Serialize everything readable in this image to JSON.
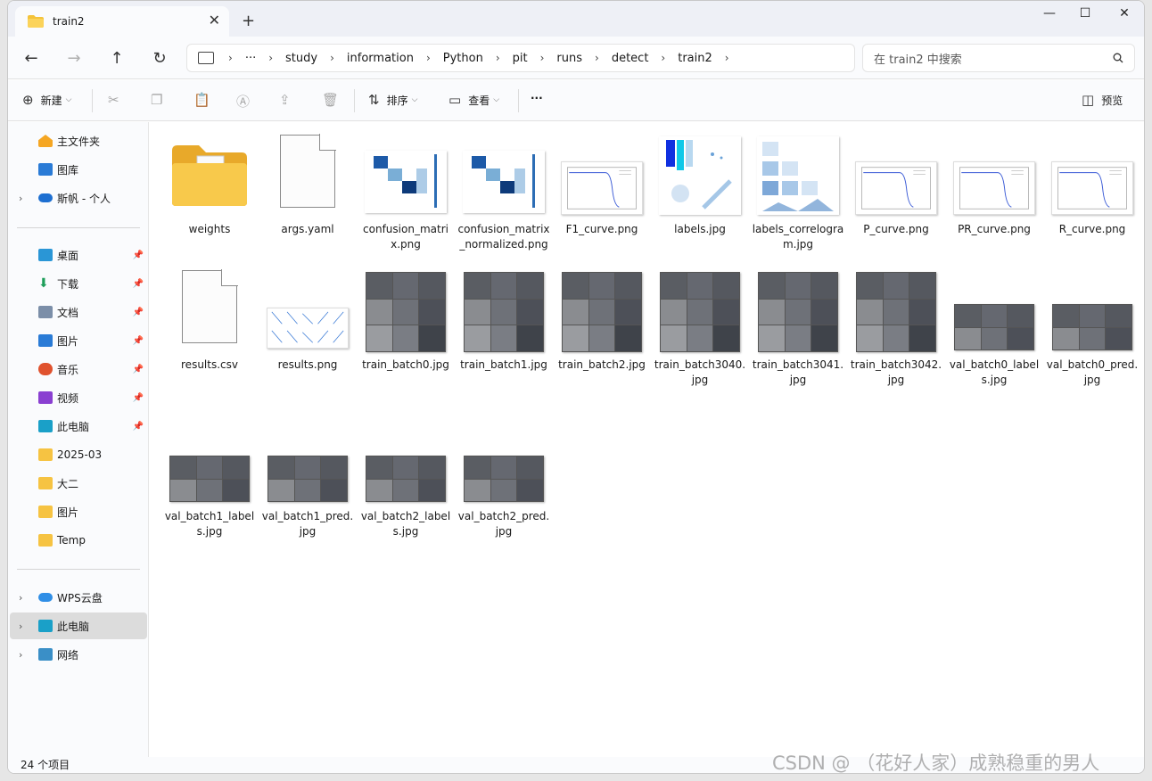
{
  "window": {
    "tab_title": "train2",
    "new_tab": "+",
    "minimize": "—",
    "maximize": "☐",
    "close": "✕"
  },
  "nav": {
    "back": "←",
    "forward": "→",
    "up": "↑",
    "refresh": "↻",
    "more": "···",
    "breadcrumbs": [
      "study",
      "information",
      "Python",
      "pit",
      "runs",
      "detect",
      "train2"
    ],
    "search_placeholder": "在 train2 中搜索"
  },
  "toolbar": {
    "new_label": "新建",
    "sort_label": "排序",
    "view_label": "查看",
    "more_label": "···",
    "preview_label": "预览"
  },
  "sidebar": {
    "home": "主文件夹",
    "gallery": "图库",
    "onedrive": "斯帆 - 个人",
    "desktop": "桌面",
    "downloads": "下载",
    "documents": "文档",
    "pictures": "图片",
    "music": "音乐",
    "videos": "视频",
    "thispc_pinned": "此电脑",
    "folder_2025": "2025-03",
    "folder_daer": "大二",
    "folder_pics": "图片",
    "folder_temp": "Temp",
    "wps": "WPS云盘",
    "thispc": "此电脑",
    "network": "网络"
  },
  "files": [
    {
      "name": "weights",
      "kind": "folder"
    },
    {
      "name": "args.yaml",
      "kind": "doc"
    },
    {
      "name": "confusion_matrix.png",
      "kind": "matrix"
    },
    {
      "name": "confusion_matrix_normalized.png",
      "kind": "matrix"
    },
    {
      "name": "F1_curve.png",
      "kind": "curve"
    },
    {
      "name": "labels.jpg",
      "kind": "labels"
    },
    {
      "name": "labels_correlogram.jpg",
      "kind": "correlogram"
    },
    {
      "name": "P_curve.png",
      "kind": "curve"
    },
    {
      "name": "PR_curve.png",
      "kind": "curve"
    },
    {
      "name": "R_curve.png",
      "kind": "curve"
    },
    {
      "name": "results.csv",
      "kind": "doc"
    },
    {
      "name": "results.png",
      "kind": "results"
    },
    {
      "name": "train_batch0.jpg",
      "kind": "photo"
    },
    {
      "name": "train_batch1.jpg",
      "kind": "photo"
    },
    {
      "name": "train_batch2.jpg",
      "kind": "photo"
    },
    {
      "name": "train_batch3040.jpg",
      "kind": "photo"
    },
    {
      "name": "train_batch3041.jpg",
      "kind": "photo"
    },
    {
      "name": "train_batch3042.jpg",
      "kind": "photo"
    },
    {
      "name": "val_batch0_labels.jpg",
      "kind": "photo-wide"
    },
    {
      "name": "val_batch0_pred.jpg",
      "kind": "photo-wide"
    },
    {
      "name": "val_batch1_labels.jpg",
      "kind": "photo-wide"
    },
    {
      "name": "val_batch1_pred.jpg",
      "kind": "photo-wide"
    },
    {
      "name": "val_batch2_labels.jpg",
      "kind": "photo-wide"
    },
    {
      "name": "val_batch2_pred.jpg",
      "kind": "photo-wide"
    }
  ],
  "status": {
    "item_count": "24 个项目"
  },
  "watermark": "CSDN @ （花好人家）成熟稳重的男人"
}
